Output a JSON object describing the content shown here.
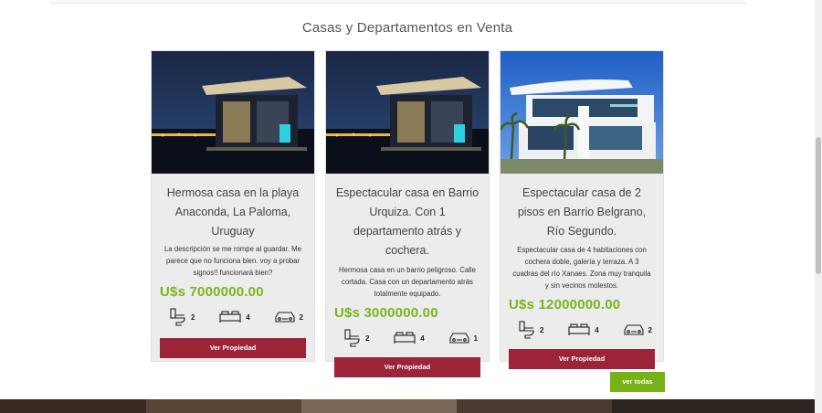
{
  "section": {
    "title": "Casas y Departamentos en Venta"
  },
  "colors": {
    "price": "#7ab51d",
    "button": "#9b2439",
    "ver_todas": "#77b116",
    "card_bg": "#ececec"
  },
  "properties": [
    {
      "title": "Hermosa casa en la playa Anaconda, La Paloma, Uruguay",
      "description": "La descripción se me rompe al guardar. Me parece que no funciona bien. voy a probar signos!! funcionará bien?",
      "price": "U$s 7000000.00",
      "bathrooms": "2",
      "bedrooms": "4",
      "garages": "2",
      "button": "Ver Propiedad",
      "image": "night-beach-house"
    },
    {
      "title": "Espectacular casa en Barrio Urquiza. Con 1 departamento atrás y cochera.",
      "description": "Hermosa casa en un barrio peligroso. Calle cortada. Casa con un departamento atrás totalmente equipado.",
      "price": "U$s 3000000.00",
      "bathrooms": "2",
      "bedrooms": "4",
      "garages": "1",
      "button": "Ver Propiedad",
      "image": "night-beach-house"
    },
    {
      "title": "Espectacular casa de 2 pisos en Barrio Belgrano, Río Segundo.",
      "description": "Espectacular casa de 4 habitaciones con cochera doble, galería y terraza. A 3 cuadras del río Xanaes. Zona muy tranquila y sin vecinos molestos.",
      "price": "U$s 12000000.00",
      "bathrooms": "2",
      "bedrooms": "4",
      "garages": "2",
      "button": "Ver Propiedad",
      "image": "modern-white-house"
    }
  ],
  "ver_todas": "ver todas",
  "icons": {
    "bathroom": "toilet-icon",
    "bedroom": "bed-icon",
    "garage": "car-icon"
  }
}
